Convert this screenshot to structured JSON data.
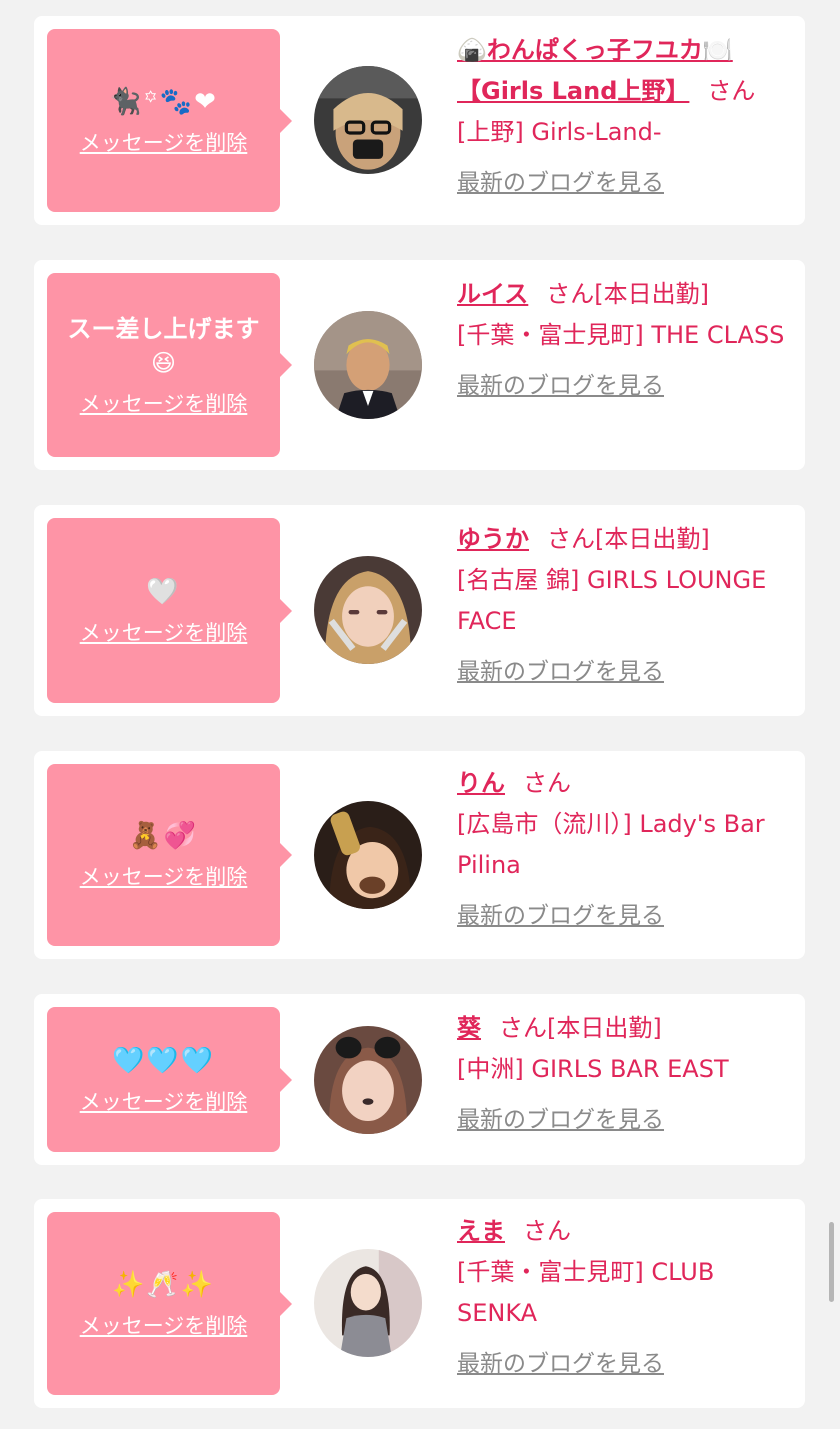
{
  "entries": [
    {
      "message": "🐈‍⬛꙳🐾❤",
      "message_is_emoji": true,
      "delete_label": "メッセージを削除",
      "name": "🍙わんぱくっ子フユカ🍽️【Girls Land上野】",
      "honorific": "さん",
      "status": "",
      "shop": "[上野] Girls-Land-",
      "blog_label": "最新のブログを見る"
    },
    {
      "message": "スー差し上げます😆",
      "message_is_emoji": false,
      "delete_label": "メッセージを削除",
      "name": "ルイス",
      "honorific": "さん",
      "status": "[本日出勤]",
      "shop": "[千葉・富士見町] THE CLASS",
      "blog_label": "最新のブログを見る"
    },
    {
      "message": "🤍",
      "message_is_emoji": true,
      "delete_label": "メッセージを削除",
      "name": "ゆうか",
      "honorific": "さん",
      "status": "[本日出勤]",
      "shop": "[名古屋 錦] GIRLS LOUNGE FACE",
      "blog_label": "最新のブログを見る"
    },
    {
      "message": "🧸💞",
      "message_is_emoji": true,
      "delete_label": "メッセージを削除",
      "name": "りん",
      "honorific": "さん",
      "status": "",
      "shop": "[広島市（流川）] Lady's Bar Pilina",
      "blog_label": "最新のブログを見る"
    },
    {
      "message": "🩵🩵🩵",
      "message_is_emoji": true,
      "delete_label": "メッセージを削除",
      "name": "葵",
      "honorific": "さん",
      "status": "[本日出勤]",
      "shop": "[中洲] GIRLS BAR EAST",
      "blog_label": "最新のブログを見る"
    },
    {
      "message": "✨🥂✨",
      "message_is_emoji": true,
      "delete_label": "メッセージを削除",
      "name": "えま",
      "honorific": "さん",
      "status": "",
      "shop": "[千葉・富士見町] CLUB SENKA",
      "blog_label": "最新のブログを見る"
    }
  ],
  "colors": {
    "page_background": "#f2f2f2",
    "card_background": "#ffffff",
    "bubble": "#fe94a6",
    "accent_text": "#e0265a",
    "muted_link": "#8a8a8a"
  }
}
